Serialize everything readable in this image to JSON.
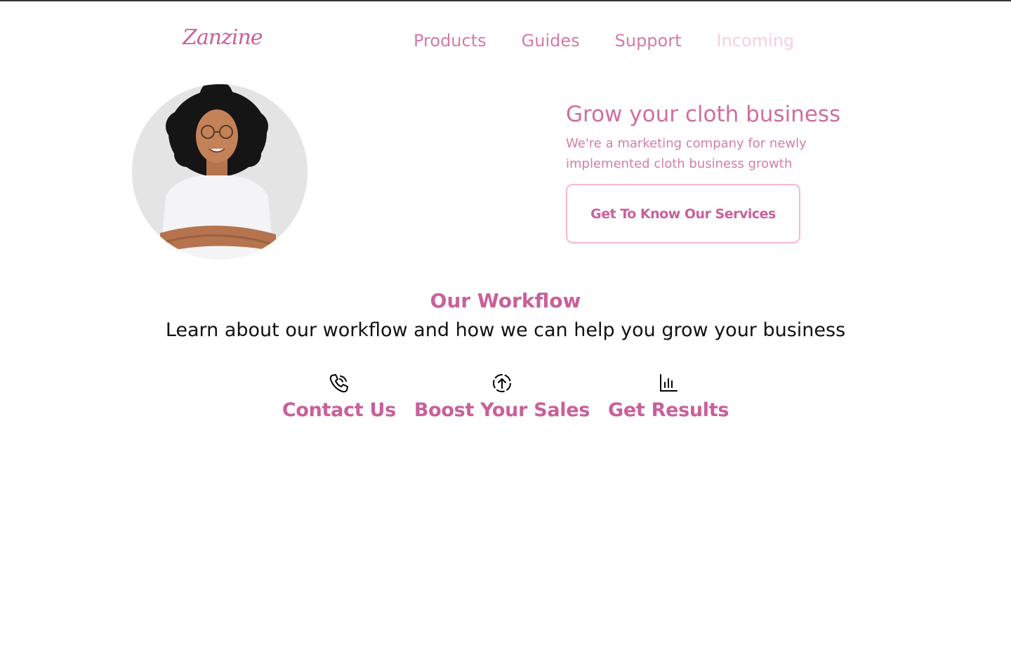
{
  "brand": {
    "logo": "Zanzine"
  },
  "nav": {
    "items": [
      {
        "label": "Products"
      },
      {
        "label": "Guides"
      },
      {
        "label": "Support"
      },
      {
        "label": "Incoming"
      }
    ]
  },
  "hero": {
    "title": "Grow your cloth business",
    "subtitle": "We're a marketing company for newly implemented cloth business growth",
    "cta_label": "Get To Know Our Services",
    "image_alt": "woman-portrait"
  },
  "workflow": {
    "title": "Our Workflow",
    "subtitle": "Learn about our workflow and how we can help you grow your business",
    "steps": [
      {
        "label": "Contact Us",
        "icon": "phone-call-icon"
      },
      {
        "label": "Boost Your Sales",
        "icon": "circle-arrow-up-icon"
      },
      {
        "label": "Get Results",
        "icon": "bar-chart-icon"
      }
    ]
  },
  "colors": {
    "accent": "#c9609a",
    "nav": "#d57aa6",
    "nav_faded": "#f6cfe0",
    "cta_border": "#f7b8cd"
  }
}
